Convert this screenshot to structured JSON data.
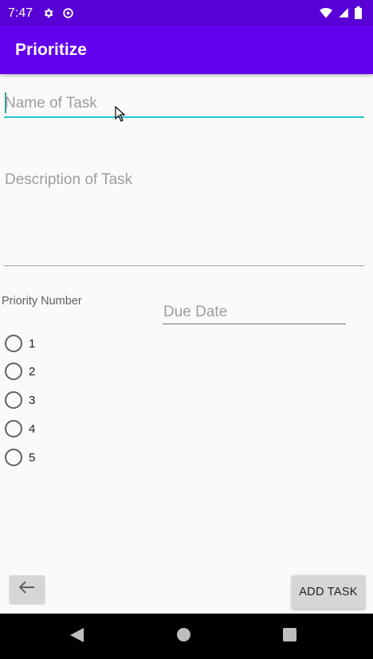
{
  "status_bar": {
    "time": "7:47",
    "icons_left": [
      "gear-icon",
      "data-saver-icon"
    ],
    "icons_right": [
      "wifi-icon",
      "signal-icon",
      "battery-icon"
    ]
  },
  "app_bar": {
    "title": "Prioritize",
    "color": "#6200ee"
  },
  "form": {
    "name_placeholder": "Name of Task",
    "description_placeholder": "Description of Task",
    "priority_label": "Priority Number",
    "due_date_placeholder": "Due Date",
    "priority_options": [
      "1",
      "2",
      "3",
      "4",
      "5"
    ]
  },
  "buttons": {
    "back_icon": "arrow-left-icon",
    "add_task": "ADD TASK"
  },
  "nav_bar": {
    "icons": [
      "back-triangle-icon",
      "home-circle-icon",
      "recents-square-icon"
    ]
  }
}
